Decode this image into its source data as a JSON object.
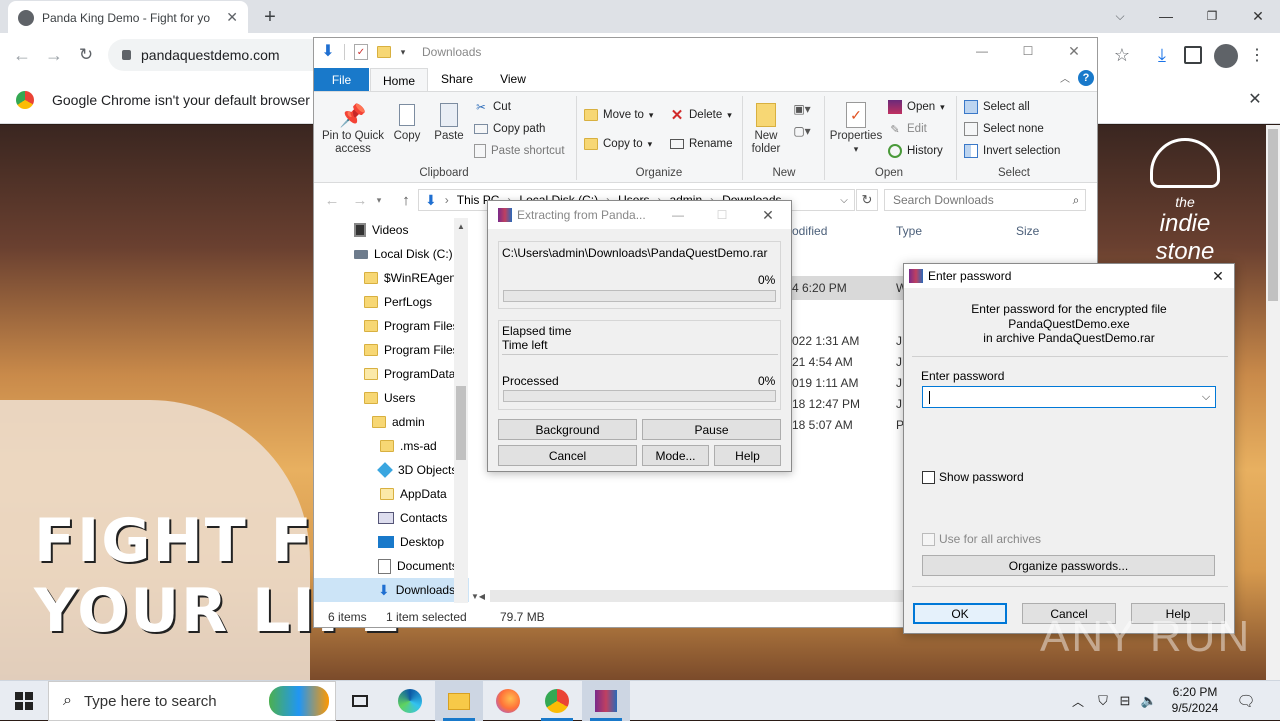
{
  "chrome": {
    "tab_title": "Panda King Demo - Fight for yo",
    "url": "pandaquestdemo.com",
    "infobar_text": "Google Chrome isn't your default browser"
  },
  "page": {
    "headline_line1": "FIGHT FOR",
    "headline_line2": "YOUR LIFE",
    "brand_line1": "the",
    "brand_line2": "indie stone"
  },
  "explorer": {
    "title": "Downloads",
    "tabs": [
      "File",
      "Home",
      "Share",
      "View"
    ],
    "clipboard": {
      "pin": "Pin to Quick access",
      "copy": "Copy",
      "paste": "Paste",
      "cut": "Cut",
      "copy_path": "Copy path",
      "paste_shortcut": "Paste shortcut",
      "group": "Clipboard"
    },
    "organize": {
      "move_to": "Move to",
      "copy_to": "Copy to",
      "delete": "Delete",
      "rename": "Rename",
      "group": "Organize"
    },
    "new": {
      "new_folder": "New folder",
      "group": "New"
    },
    "open": {
      "properties": "Properties",
      "open": "Open",
      "edit": "Edit",
      "history": "History",
      "group": "Open"
    },
    "select": {
      "select_all": "Select all",
      "select_none": "Select none",
      "invert": "Invert selection",
      "group": "Select"
    },
    "breadcrumb": [
      "This PC",
      "Local Disk (C:)",
      "Users",
      "admin",
      "Downloads"
    ],
    "search_placeholder": "Search Downloads",
    "columns": [
      "odified",
      "Type",
      "Size"
    ],
    "nav": [
      "Videos",
      "Local Disk (C:)",
      "$WinREAgent",
      "PerfLogs",
      "Program Files",
      "Program Files",
      "ProgramData",
      "Users",
      "admin",
      ".ms-ad",
      "3D Objects",
      "AppData",
      "Contacts",
      "Desktop",
      "Documents",
      "Downloads"
    ],
    "rows": [
      {
        "date": "4 6:20 PM",
        "type": "W"
      },
      {
        "date": "022 1:31 AM",
        "type": "JP"
      },
      {
        "date": "21 4:54 AM",
        "type": "JP"
      },
      {
        "date": "019 1:11 AM",
        "type": "JP"
      },
      {
        "date": "18 12:47 PM",
        "type": "JP"
      },
      {
        "date": "18 5:07 AM",
        "type": "Pl"
      }
    ],
    "status_items": "6 items",
    "status_selected": "1 item selected",
    "status_size": "79.7 MB"
  },
  "extract": {
    "title": "Extracting from Panda...",
    "path": "C:\\Users\\admin\\Downloads\\PandaQuestDemo.rar",
    "percent1": "0%",
    "progress1": 0,
    "elapsed": "Elapsed time",
    "time_left": "Time left",
    "processed": "Processed",
    "percent2": "0%",
    "progress2": 0,
    "buttons": {
      "background": "Background",
      "pause": "Pause",
      "cancel": "Cancel",
      "mode": "Mode...",
      "help": "Help"
    }
  },
  "password": {
    "title": "Enter password",
    "msg1": "Enter password for the encrypted file",
    "msg2": "PandaQuestDemo.exe",
    "msg3": "in archive PandaQuestDemo.rar",
    "field_label": "Enter password",
    "value": "",
    "show_password": "Show password",
    "use_all": "Use for all archives",
    "organize": "Organize passwords...",
    "ok": "OK",
    "cancel": "Cancel",
    "help": "Help"
  },
  "taskbar": {
    "search_placeholder": "Type here to search",
    "time": "6:20 PM",
    "date": "9/5/2024"
  },
  "watermark": "ANY RUN"
}
